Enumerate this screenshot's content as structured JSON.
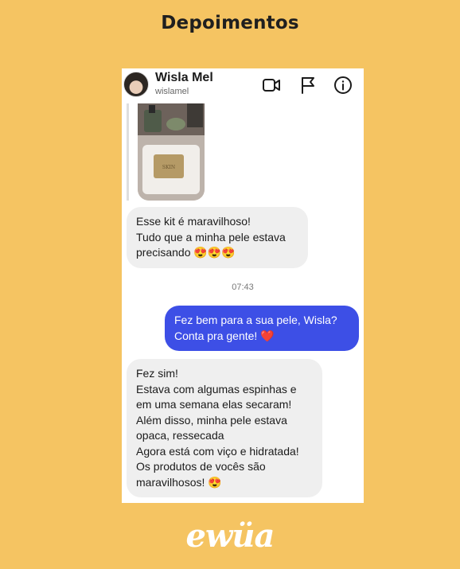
{
  "page": {
    "title": "Depoimentos"
  },
  "chat": {
    "contact_name": "Wisla Mel",
    "contact_handle": "wislamel",
    "header_icons": [
      "video-icon",
      "flag-icon",
      "info-icon"
    ]
  },
  "messages": [
    {
      "direction": "incoming",
      "text": "Esse kit é maravilhoso!\nTudo que a minha pele estava\nprecisando 😍😍😍"
    },
    {
      "timestamp": "07:43"
    },
    {
      "direction": "outgoing",
      "text": "Fez bem para a sua pele, Wisla?\nConta pra gente! ❤️"
    },
    {
      "direction": "incoming",
      "text": "Fez sim!\nEstava com algumas espinhas e\nem uma semana elas secaram!\nAlém disso, minha pele estava\nopaca, ressecada\nAgora está com viço e hidratada!\nOs produtos de vocês são\nmaravilhosos! 😍"
    }
  ],
  "brand": {
    "logo_text": "ewüa"
  },
  "colors": {
    "background": "#F5C462",
    "outgoing_bubble": "#3D4FE6",
    "incoming_bubble": "#EFEFEF"
  }
}
